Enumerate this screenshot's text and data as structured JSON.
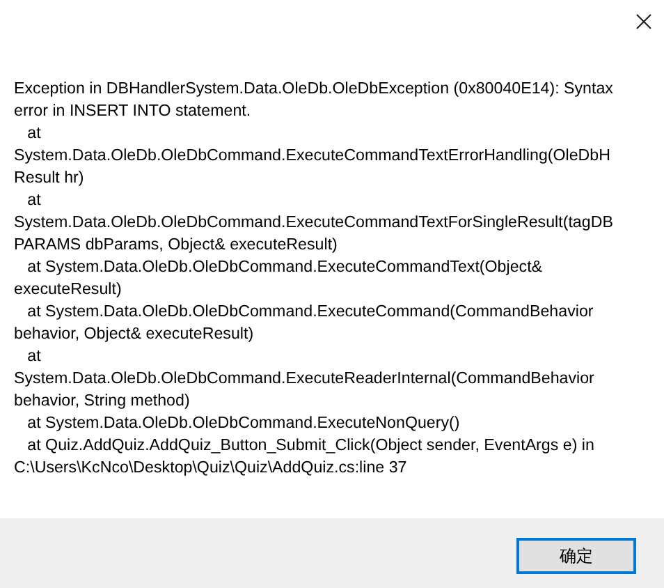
{
  "dialog": {
    "message_lines": [
      "Exception in DBHandlerSystem.Data.OleDb.OleDbException (0x80040E14): Syntax",
      "error in INSERT INTO statement.",
      "   at",
      "System.Data.OleDb.OleDbCommand.ExecuteCommandTextErrorHandling(OleDbH",
      "Result hr)",
      "   at",
      "System.Data.OleDb.OleDbCommand.ExecuteCommandTextForSingleResult(tagDB",
      "PARAMS dbParams, Object& executeResult)",
      "   at System.Data.OleDb.OleDbCommand.ExecuteCommandText(Object&",
      "executeResult)",
      "   at System.Data.OleDb.OleDbCommand.ExecuteCommand(CommandBehavior",
      "behavior, Object& executeResult)",
      "   at",
      "System.Data.OleDb.OleDbCommand.ExecuteReaderInternal(CommandBehavior",
      "behavior, String method)",
      "   at System.Data.OleDb.OleDbCommand.ExecuteNonQuery()",
      "   at Quiz.AddQuiz.AddQuiz_Button_Submit_Click(Object sender, EventArgs e) in",
      "C:\\Users\\KcNco\\Desktop\\Quiz\\Quiz\\AddQuiz.cs:line 37"
    ],
    "buttons": [
      {
        "label": "确定",
        "selected": true
      }
    ]
  }
}
